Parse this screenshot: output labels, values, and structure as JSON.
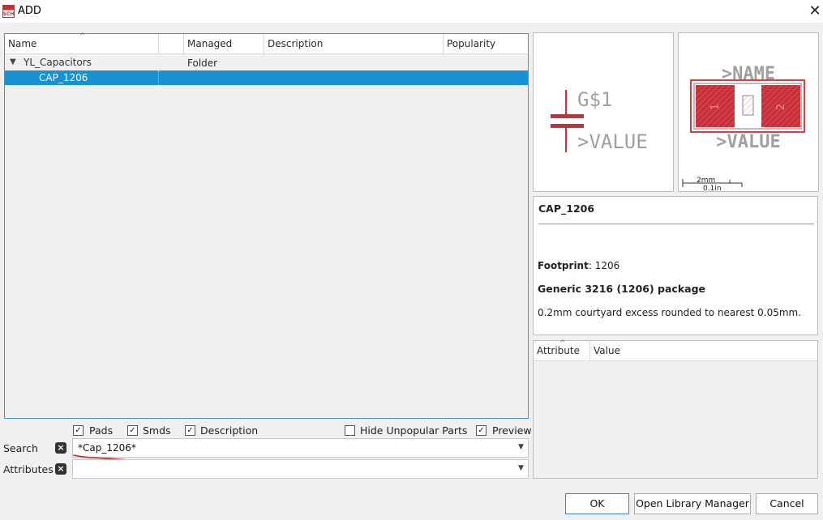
{
  "window": {
    "title": "ADD",
    "icon_text": "SCH"
  },
  "tree": {
    "columns": [
      "Name",
      "",
      "Managed Folder",
      "Description",
      "Popularity"
    ],
    "group": "YL_Capacitors",
    "selected_item": "CAP_1206"
  },
  "options": {
    "pads": "Pads",
    "smds": "Smds",
    "description": "Description",
    "hide_unpopular": "Hide Unpopular Parts",
    "preview": "Preview"
  },
  "search": {
    "label": "Search",
    "value": "*Cap_1206*"
  },
  "attributes_filter": {
    "label": "Attributes",
    "value": ""
  },
  "symbol_preview": {
    "name_text": "G$1",
    "value_text": ">VALUE"
  },
  "package_preview": {
    "name_text": ">NAME",
    "value_text": ">VALUE",
    "pad1": "1",
    "pad2": "2",
    "scale_mm": "2mm",
    "scale_in": "0.1in"
  },
  "info": {
    "name": "CAP_1206",
    "footprint_label": "Footprint",
    "footprint_sep": ":",
    "footprint_value": "1206",
    "package_title": "Generic 3216 (1206) package",
    "note": "0.2mm courtyard excess rounded to nearest 0.05mm."
  },
  "attribute_table": {
    "columns": [
      "Attribute",
      "Value"
    ]
  },
  "buttons": {
    "ok": "OK",
    "library_manager": "Open Library Manager",
    "cancel": "Cancel"
  },
  "colors": {
    "selection": "#1791d3",
    "symbol": "#c8303a",
    "text_gray": "#a0a0a0",
    "annotation": "#d42020"
  }
}
